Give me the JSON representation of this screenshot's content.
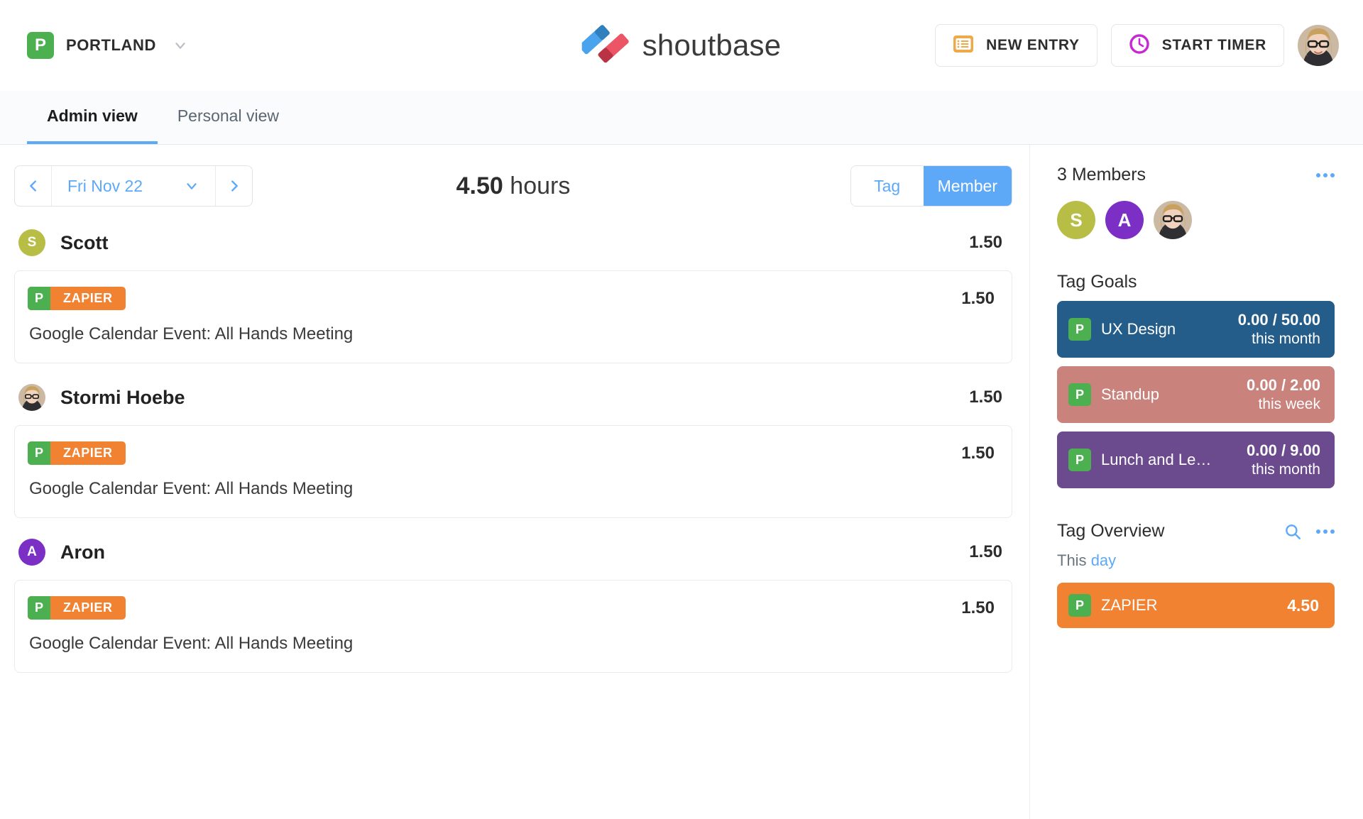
{
  "header": {
    "org_initial": "P",
    "org_name": "PORTLAND",
    "brand_name": "shoutbase",
    "new_entry_label": "NEW ENTRY",
    "start_timer_label": "START TIMER"
  },
  "tabs": [
    {
      "label": "Admin view",
      "active": true
    },
    {
      "label": "Personal view",
      "active": false
    }
  ],
  "toolbar": {
    "date_label": "Fri Nov 22",
    "total_value": "4.50",
    "total_unit": "hours",
    "segment_tag": "Tag",
    "segment_member": "Member"
  },
  "groups": [
    {
      "name": "Scott",
      "initial": "S",
      "avatar_color": "#b8bd45",
      "avatar_type": "initial",
      "hours": "1.50",
      "entries": [
        {
          "tag_prefix": "P",
          "tag_name": "ZAPIER",
          "tag_color": "#f08232",
          "hours": "1.50",
          "description": "Google Calendar Event: All Hands Meeting"
        }
      ]
    },
    {
      "name": "Stormi Hoebe",
      "initial": "S",
      "avatar_color": "#d9c9b6",
      "avatar_type": "photo",
      "hours": "1.50",
      "entries": [
        {
          "tag_prefix": "P",
          "tag_name": "ZAPIER",
          "tag_color": "#f08232",
          "hours": "1.50",
          "description": "Google Calendar Event: All Hands Meeting"
        }
      ]
    },
    {
      "name": "Aron",
      "initial": "A",
      "avatar_color": "#7b2fc4",
      "avatar_type": "initial",
      "hours": "1.50",
      "entries": [
        {
          "tag_prefix": "P",
          "tag_name": "ZAPIER",
          "tag_color": "#f08232",
          "hours": "1.50",
          "description": "Google Calendar Event: All Hands Meeting"
        }
      ]
    }
  ],
  "sidebar": {
    "members_title": "3 Members",
    "members": [
      {
        "initial": "S",
        "color": "#b8bd45",
        "type": "initial"
      },
      {
        "initial": "A",
        "color": "#7b2fc4",
        "type": "initial"
      },
      {
        "initial": "",
        "color": "#d9c9b6",
        "type": "photo"
      }
    ],
    "tag_goals_title": "Tag Goals",
    "tag_goals": [
      {
        "prefix": "P",
        "name": "UX Design",
        "value": "0.00 / 50.00",
        "period": "this month",
        "color": "#255d8a"
      },
      {
        "prefix": "P",
        "name": "Standup",
        "value": "0.00 / 2.00",
        "period": "this week",
        "color": "#c9827c"
      },
      {
        "prefix": "P",
        "name": "Lunch and Le…",
        "value": "0.00 / 9.00",
        "period": "this month",
        "color": "#6b4a8e"
      }
    ],
    "tag_overview_title": "Tag Overview",
    "tag_overview_scope_prefix": "This ",
    "tag_overview_scope": "day",
    "tag_overview_rows": [
      {
        "prefix": "P",
        "name": "ZAPIER",
        "value": "4.50",
        "color": "#f08232"
      }
    ]
  },
  "icons": {
    "org_caret": "chevron-down-icon",
    "new_entry": "list-icon",
    "start_timer": "clock-icon",
    "prev": "chevron-left-icon",
    "next": "chevron-right-icon",
    "search": "search-icon",
    "more": "more-dots-icon"
  }
}
